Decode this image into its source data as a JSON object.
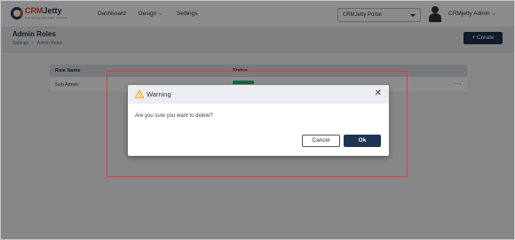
{
  "brand": {
    "name_part1": "CRM",
    "name_part2": "Jetty",
    "tagline": "Empowering CRM & ERP Solutions"
  },
  "nav": {
    "items": [
      {
        "label": "Dashboard"
      },
      {
        "label": "Design"
      },
      {
        "label": "Settings"
      }
    ],
    "portal_select": "CRMJetty Portal",
    "user_name": "CRMjetty Admin"
  },
  "page": {
    "title": "Admin Roles",
    "breadcrumb": [
      "Settings",
      "Admin Roles"
    ],
    "create_label": "+ Create"
  },
  "table": {
    "columns": [
      "Role Name",
      "Status"
    ],
    "rows": [
      {
        "role_name": "Sub Admin",
        "status": "active",
        "actions_icon": "more-horizontal-icon"
      }
    ]
  },
  "dialog": {
    "title": "Warning",
    "message": "Are you sure you want to delete?",
    "cancel_label": "Cancel",
    "ok_label": "Ok"
  },
  "colors": {
    "primary": "#1e3454",
    "accent": "#e0452f",
    "status_active": "#2bb673",
    "annotation": "#e23c3c",
    "warning": "#f0a500"
  }
}
